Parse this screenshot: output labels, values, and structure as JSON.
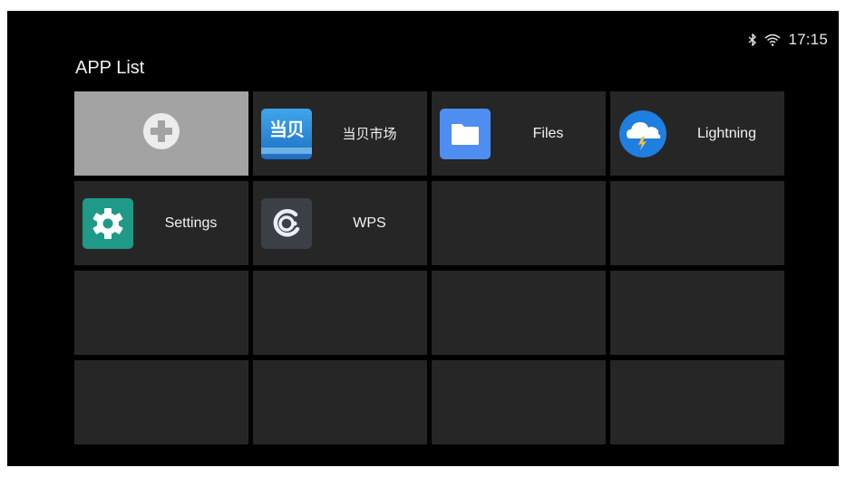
{
  "status_bar": {
    "icons": [
      "bluetooth-icon",
      "wifi-icon"
    ],
    "time": "17:15"
  },
  "page": {
    "title": "APP List"
  },
  "tiles": [
    {
      "kind": "add",
      "icon": "add-icon"
    },
    {
      "kind": "app",
      "label": "当贝市场",
      "icon": "dangbei-market-icon",
      "icon_text": "当贝"
    },
    {
      "kind": "app",
      "label": "Files",
      "icon": "files-folder-icon"
    },
    {
      "kind": "app",
      "label": "Lightning",
      "icon": "lightning-cloud-icon"
    },
    {
      "kind": "app",
      "label": "Settings",
      "icon": "settings-gear-icon"
    },
    {
      "kind": "app",
      "label": "WPS",
      "icon": "wps-icon"
    },
    {
      "kind": "empty"
    },
    {
      "kind": "empty"
    },
    {
      "kind": "empty"
    },
    {
      "kind": "empty"
    },
    {
      "kind": "empty"
    },
    {
      "kind": "empty"
    },
    {
      "kind": "empty"
    },
    {
      "kind": "empty"
    },
    {
      "kind": "empty"
    },
    {
      "kind": "empty"
    }
  ],
  "colors": {
    "screen_bg": "#000000",
    "tile_bg": "#262626",
    "add_tile_bg": "#a3a3a3",
    "text": "#f2f2f2"
  }
}
